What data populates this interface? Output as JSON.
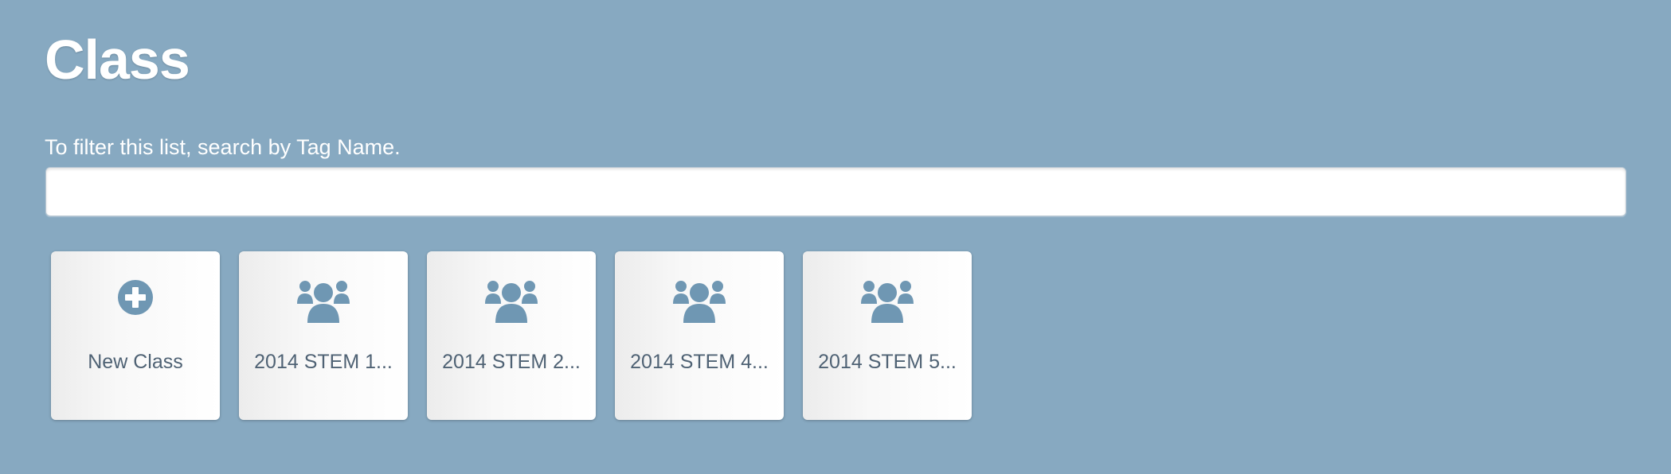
{
  "page": {
    "title": "Class",
    "filter_hint": "To filter this list, search by Tag Name.",
    "search": {
      "value": "",
      "placeholder": ""
    }
  },
  "tiles": [
    {
      "label": "New Class",
      "icon": "plus-circle-icon"
    },
    {
      "label": "2014 STEM 1...",
      "icon": "group-icon"
    },
    {
      "label": "2014 STEM 2...",
      "icon": "group-icon"
    },
    {
      "label": "2014 STEM 4...",
      "icon": "group-icon"
    },
    {
      "label": "2014 STEM 5...",
      "icon": "group-icon"
    }
  ],
  "colors": {
    "background": "#87a9c1",
    "icon": "#6f97b3",
    "tile_text": "#4f6274",
    "title_text": "#ffffff"
  }
}
